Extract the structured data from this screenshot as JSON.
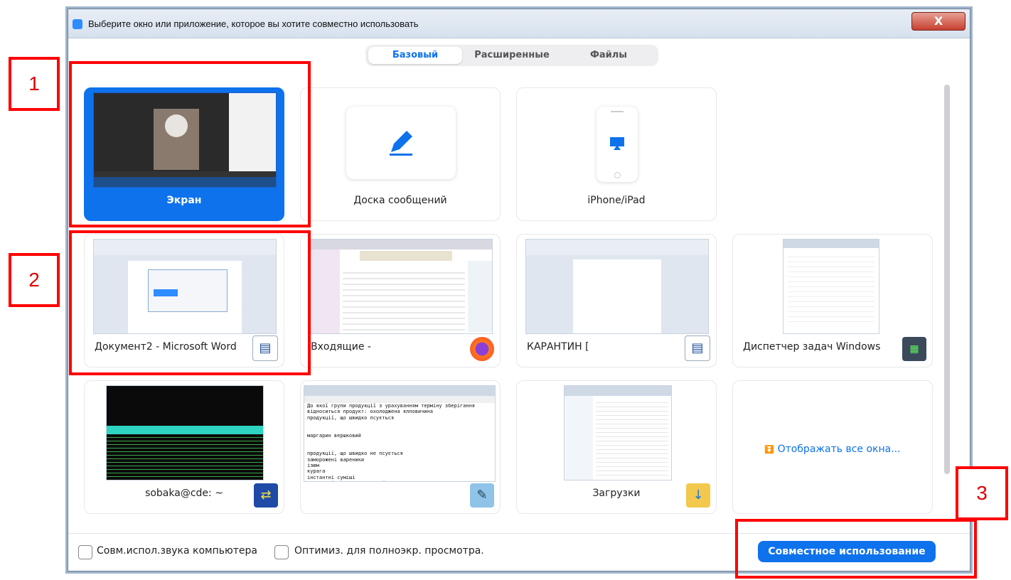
{
  "window": {
    "title": "Выберите окно или приложение, которое вы хотите совместно использовать",
    "close_symbol": "X"
  },
  "tabs": [
    {
      "label": "Базовый",
      "active": true
    },
    {
      "label": "Расширенные",
      "active": false
    },
    {
      "label": "Файлы",
      "active": false
    }
  ],
  "tiles": [
    {
      "label": "Экран"
    },
    {
      "label": "Доска сообщений",
      "icon": "pencil-icon"
    },
    {
      "label": "iPhone/iPad",
      "icon": "airplay-icon"
    },
    {
      "label": "Документ2 - Microsoft Word",
      "icon": "word-document-icon"
    },
    {
      "label": "Входящие -",
      "icon": "firefox-icon"
    },
    {
      "label": "КАРАНТИН [",
      "icon": "word-document-icon"
    },
    {
      "label": "Диспетчер задач Windows",
      "icon": "task-manager-icon"
    },
    {
      "label": "sobaka@cde: ~",
      "icon": "network-terminal-icon"
    },
    {
      "label": "",
      "icon": "notepad-icon"
    },
    {
      "label": "Загрузки",
      "icon": "folder-download-icon"
    },
    {
      "label": "Отображать все окна...",
      "icon": "chevron-double-down-icon"
    }
  ],
  "notepad_text": "До якої групи продукції з урахуванням терміну зберігання відноситься продукт: охолоджена ялловичина\nпродукції, що швидко псується\n\n\nмаргарин вершковий\n\n\nпродукції, що швидко не псується\nзаморожені вареники\nізюм\nкурага\nінстантні суміші\nгороховий суп брикетований",
  "bottom": {
    "share_audio_label": "Совм.испол.звука компьютера",
    "optimize_label": "Оптимиз. для полноэкр. просмотра.",
    "share_button_label": "Совместное использование"
  },
  "annotations": [
    "1",
    "2",
    "3"
  ],
  "colors": {
    "accent": "#0e72ed",
    "annotation": "#ff0000"
  }
}
